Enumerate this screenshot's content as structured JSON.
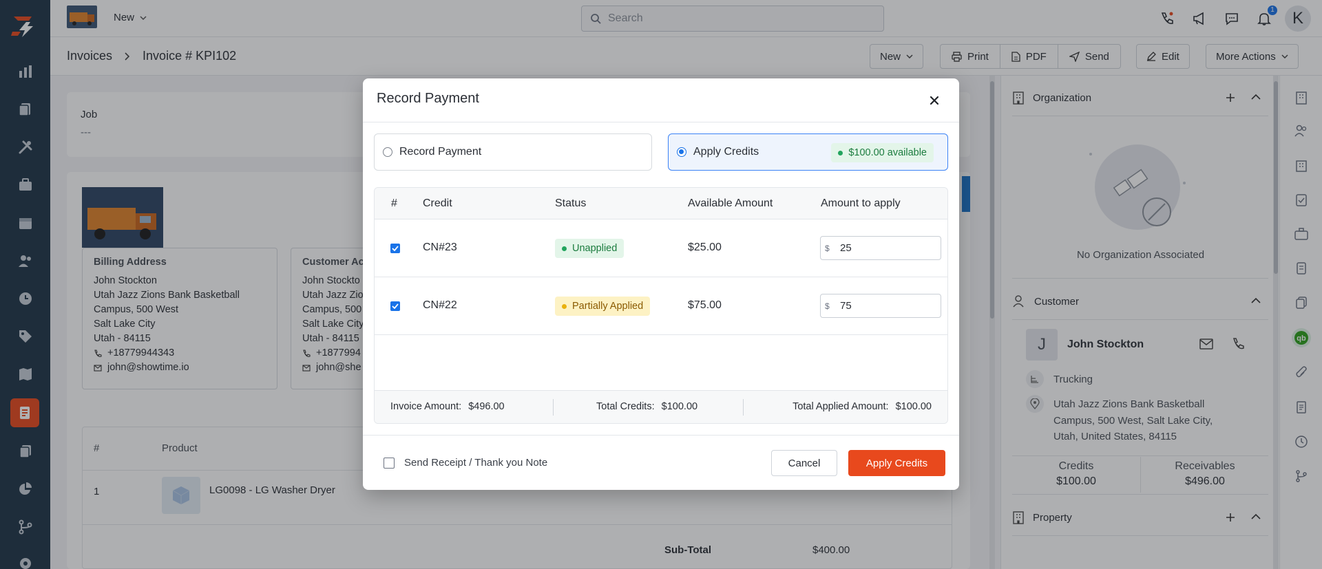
{
  "topbar": {
    "new_label": "New",
    "search_placeholder": "Search",
    "notification_count": "1",
    "avatar_letter": "K"
  },
  "breadcrumb": {
    "root": "Invoices",
    "current": "Invoice # KPI102"
  },
  "toolbar": {
    "new_label": "New",
    "print_label": "Print",
    "pdf_label": "PDF",
    "send_label": "Send",
    "edit_label": "Edit",
    "more_label": "More Actions"
  },
  "job": {
    "label": "Job",
    "value": "---"
  },
  "billing": {
    "title": "Billing Address",
    "name": "John Stockton",
    "line1": "Utah Jazz Zions Bank Basketball",
    "line2": "Campus, 500 West",
    "city": "Salt Lake City",
    "state": "Utah - 84115",
    "phone": "+18779944343",
    "email": "john@showtime.io"
  },
  "customer_address": {
    "title": "Customer Ac",
    "name": "John Stockto",
    "line1": "Utah Jazz Zio",
    "line2": "Campus, 500",
    "city": "Salt Lake City",
    "state": "Utah - 84115",
    "phone": "+1877994",
    "email": "john@she"
  },
  "items": {
    "col_num": "#",
    "col_product": "Product",
    "rows": [
      {
        "num": "1",
        "product": "LG0098 - LG Washer Dryer"
      }
    ],
    "subtotal_label": "Sub-Total",
    "subtotal_value": "$400.00"
  },
  "right_panel": {
    "organization_title": "Organization",
    "no_org": "No Organization Associated",
    "customer_title": "Customer",
    "customer_initial": "J",
    "customer_name": "John Stockton",
    "customer_type": "Trucking",
    "customer_address_1": "Utah Jazz Zions Bank Basketball",
    "customer_address_2": "Campus, 500 West, Salt Lake City,",
    "customer_address_3": "Utah, United States, 84115",
    "credits_label": "Credits",
    "credits_value": "$100.00",
    "receivables_label": "Receivables",
    "receivables_value": "$496.00",
    "property_title": "Property"
  },
  "modal": {
    "title": "Record Payment",
    "option_record": "Record Payment",
    "option_apply": "Apply Credits",
    "available": "$100.00 available",
    "columns": {
      "num": "#",
      "credit": "Credit",
      "status": "Status",
      "available": "Available Amount",
      "apply": "Amount to apply"
    },
    "rows": [
      {
        "credit": "CN#23",
        "status": "Unapplied",
        "available": "$25.00",
        "currency": "$",
        "amount": "25"
      },
      {
        "credit": "CN#22",
        "status": "Partially Applied",
        "available": "$75.00",
        "currency": "$",
        "amount": "75"
      }
    ],
    "footer": {
      "invoice_label": "Invoice Amount:",
      "invoice_value": "$496.00",
      "credits_label": "Total Credits:",
      "credits_value": "$100.00",
      "applied_label": "Total Applied Amount:",
      "applied_value": "$100.00"
    },
    "send_receipt": "Send Receipt / Thank you Note",
    "cancel": "Cancel",
    "apply": "Apply Credits"
  },
  "colors": {
    "accent": "#e8491d",
    "nav_bg": "#1f3547",
    "primary_blue": "#1a73e8",
    "success_bg": "#e3f5e9",
    "warning_bg": "#fdf2c4"
  }
}
